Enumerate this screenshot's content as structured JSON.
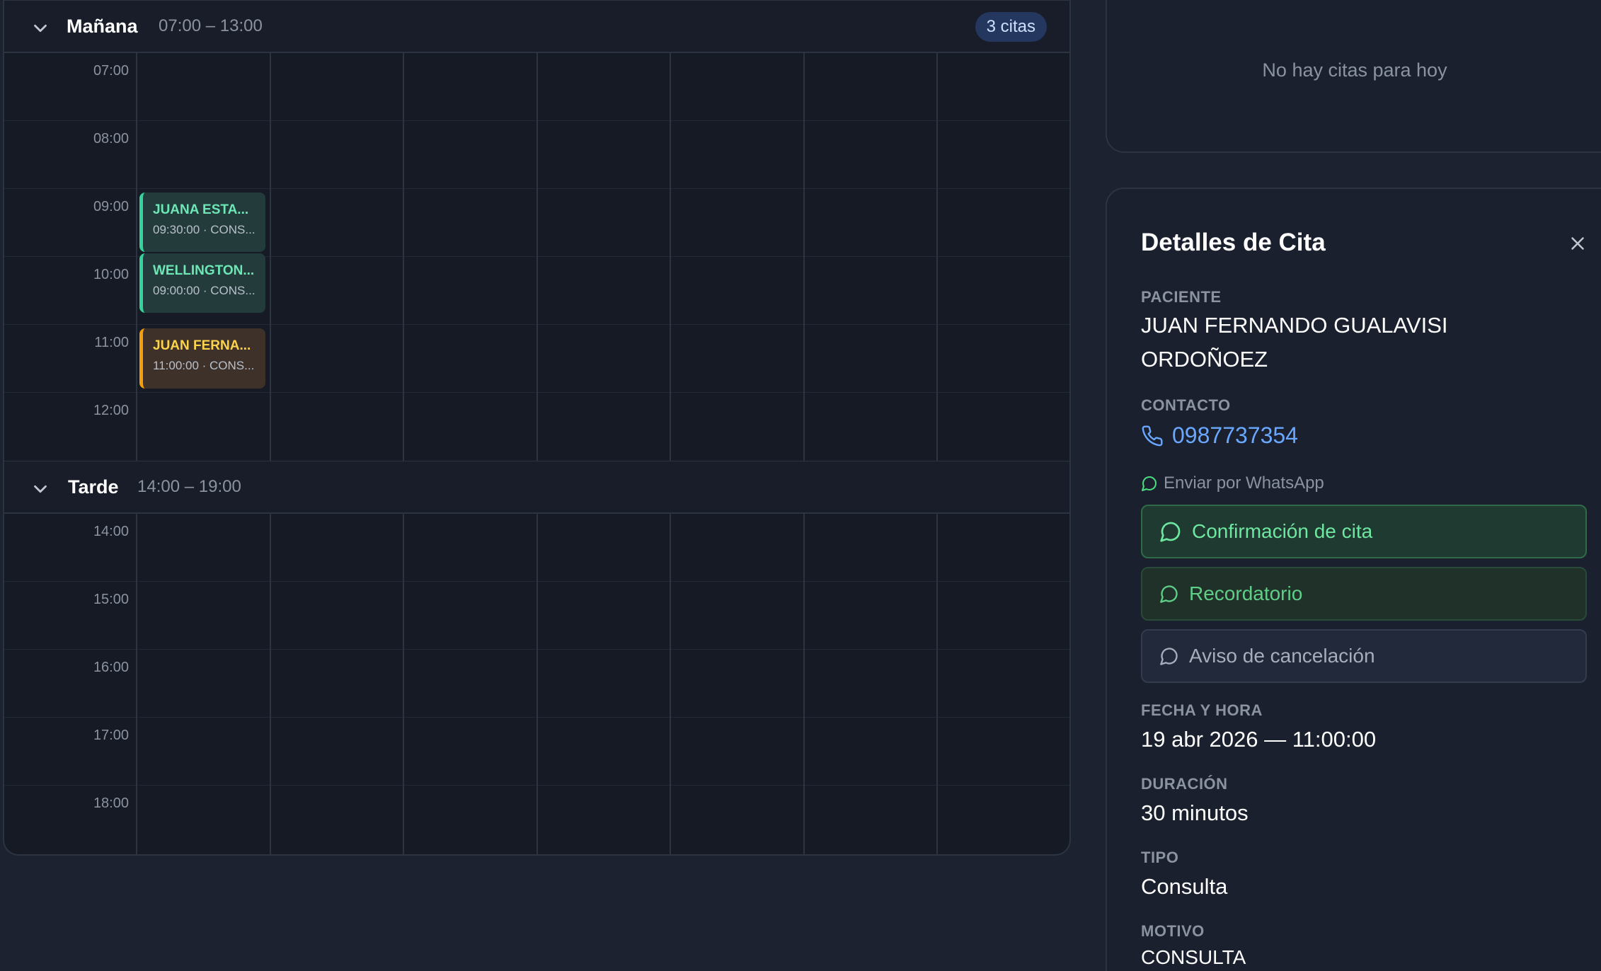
{
  "calendar": {
    "morning": {
      "title": "Mañana",
      "range": "07:00 – 13:00",
      "count_badge": "3 citas",
      "hours": [
        "07:00",
        "08:00",
        "09:00",
        "10:00",
        "11:00",
        "12:00"
      ]
    },
    "afternoon": {
      "title": "Tarde",
      "range": "14:00 – 19:00",
      "hours": [
        "14:00",
        "15:00",
        "16:00",
        "17:00",
        "18:00"
      ]
    },
    "appointments": [
      {
        "name": "JUANA ESTA...",
        "meta": "09:30:00 · CONS...",
        "status": "green"
      },
      {
        "name": "WELLINGTON...",
        "meta": "09:00:00 · CONS...",
        "status": "green"
      },
      {
        "name": "JUAN FERNA...",
        "meta": "11:00:00 · CONS...",
        "status": "amber"
      }
    ]
  },
  "today_panel": {
    "empty_text": "No hay citas para hoy"
  },
  "details": {
    "title": "Detalles de Cita",
    "patient_label": "PACIENTE",
    "patient_name_line1": "JUAN FERNANDO GUALAVISI",
    "patient_name_line2": "ORDOÑOEZ",
    "contact_label": "CONTACTO",
    "phone": "0987737354",
    "whatsapp_hint": "Enviar por WhatsApp",
    "btn_confirm": "Confirmación de cita",
    "btn_reminder": "Recordatorio",
    "btn_cancel": "Aviso de cancelación",
    "datetime_label": "FECHA Y HORA",
    "datetime": "19 abr 2026 — 11:00:00",
    "duration_label": "DURACIÓN",
    "duration": "30 minutos",
    "type_label": "TIPO",
    "type": "Consulta",
    "reason_label": "MOTIVO",
    "reason": "CONSULTA"
  },
  "colors": {
    "accent_blue": "#6aa7ff",
    "whatsapp_green": "#6ee7a0",
    "appt_green": "#34d399",
    "appt_amber": "#f59e0b"
  }
}
